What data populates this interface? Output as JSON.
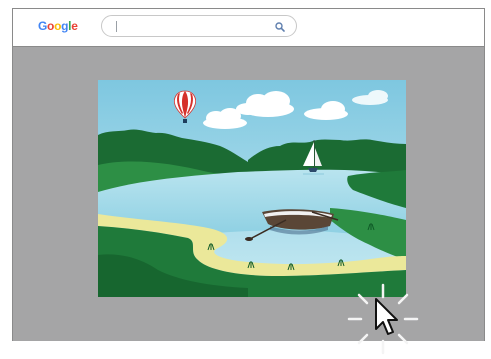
{
  "browser": {
    "logo_letters": [
      {
        "char": "G",
        "color": "#4285F4"
      },
      {
        "char": "o",
        "color": "#EA4335"
      },
      {
        "char": "o",
        "color": "#FBBC05"
      },
      {
        "char": "g",
        "color": "#4285F4"
      },
      {
        "char": "l",
        "color": "#34A853"
      },
      {
        "char": "e",
        "color": "#EA4335"
      }
    ],
    "search": {
      "value": "",
      "icon": "search-icon"
    }
  },
  "content": {
    "image": {
      "subject": "landscape-illustration",
      "sky_color": "#8fd0e6",
      "water_color": "#a9dbea",
      "grass_color": "#1f7a3a",
      "sand_color": "#e9e79a"
    },
    "cursor": {
      "icon": "mouse-pointer-icon",
      "state": "clicking"
    }
  },
  "colors": {
    "viewport_bg": "#a5a5a6",
    "frame_border": "#8a8a8a"
  }
}
